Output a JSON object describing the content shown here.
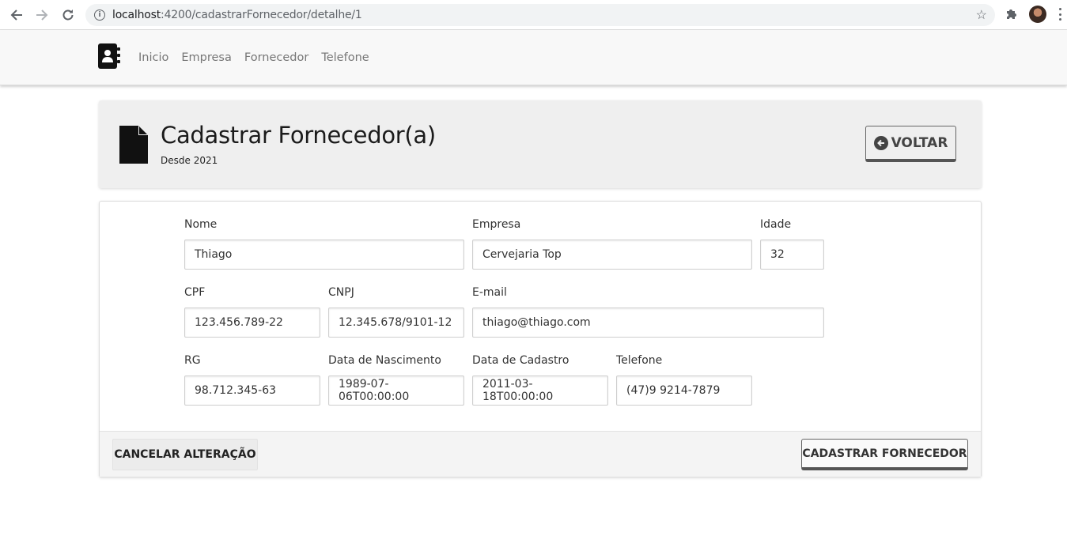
{
  "browser": {
    "url_host": "localhost",
    "url_path": ":4200/cadastrarFornecedor/detalhe/1",
    "back_icon": "arrow-left-icon",
    "forward_icon": "arrow-right-icon",
    "reload_icon": "reload-icon"
  },
  "navbar": {
    "brand_icon": "address-book-icon",
    "items": [
      {
        "label": "Inicio"
      },
      {
        "label": "Empresa"
      },
      {
        "label": "Fornecedor"
      },
      {
        "label": "Telefone"
      }
    ]
  },
  "header": {
    "title": "Cadastrar Fornecedor(a)",
    "subtitle": "Desde 2021",
    "back_button": "VOLTAR"
  },
  "form": {
    "nome": {
      "label": "Nome",
      "value": "Thiago"
    },
    "empresa": {
      "label": "Empresa",
      "value": "Cervejaria Top"
    },
    "idade": {
      "label": "Idade",
      "value": "32"
    },
    "cpf": {
      "label": "CPF",
      "value": "123.456.789-22"
    },
    "cnpj": {
      "label": "CNPJ",
      "value": "12.345.678/9101-12"
    },
    "email": {
      "label": "E-mail",
      "value": "thiago@thiago.com"
    },
    "rg": {
      "label": "RG",
      "value": "98.712.345-63"
    },
    "nascimento": {
      "label": "Data de Nascimento",
      "value": "1989-07-06T00:00:00"
    },
    "cadastro": {
      "label": "Data de Cadastro",
      "value": "2011-03-18T00:00:00"
    },
    "telefone": {
      "label": "Telefone",
      "value": "(47)9 9214-7879"
    }
  },
  "footer": {
    "cancel_button": "CANCELAR ALTERAÇÃO",
    "submit_button": "CADASTRAR FORNECEDOR"
  }
}
